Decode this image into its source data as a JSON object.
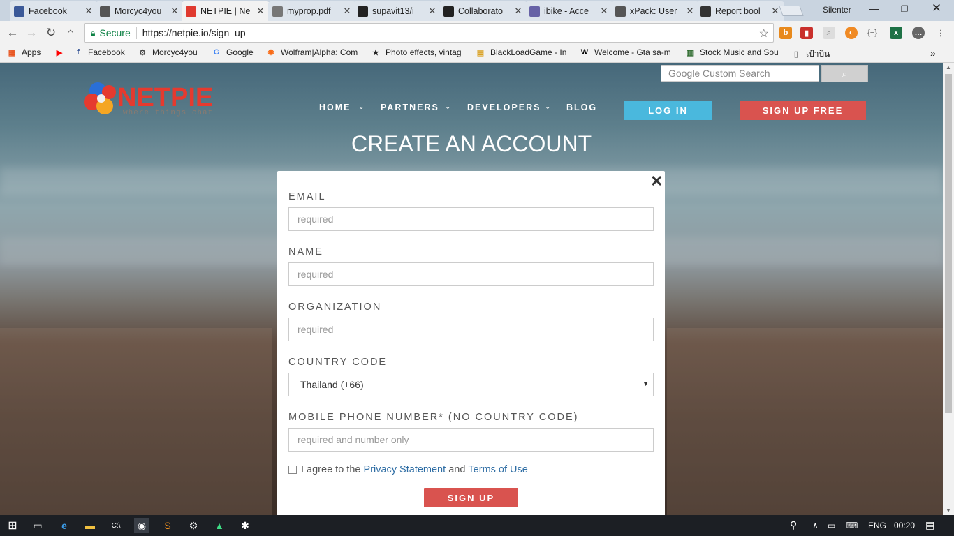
{
  "browser": {
    "tabs": [
      {
        "label": "Facebook",
        "icon": "facebook-icon",
        "color": "#3b5998"
      },
      {
        "label": "Morcyc4you",
        "icon": "motorcycle-icon",
        "color": "#555555"
      },
      {
        "label": "NETPIE | Ne",
        "icon": "netpie-icon",
        "color": "#e03a2f"
      },
      {
        "label": "myprop.pdf",
        "icon": "document-icon",
        "color": "#777777"
      },
      {
        "label": "supavit13/i",
        "icon": "github-icon",
        "color": "#222222"
      },
      {
        "label": "Collaborato",
        "icon": "github-icon",
        "color": "#222222"
      },
      {
        "label": "ibike - Acce",
        "icon": "heroku-icon",
        "color": "#6762a6"
      },
      {
        "label": "xPack: User",
        "icon": "xpack-icon",
        "color": "#555555"
      },
      {
        "label": "Report bool",
        "icon": "report-icon",
        "color": "#333333"
      }
    ],
    "profile_name": "Silenter",
    "secure_label": "Secure",
    "url": "https://netpie.io/sign_up",
    "bookmarks": [
      {
        "label": "Apps",
        "icon": "apps-grid-icon"
      },
      {
        "label": "",
        "icon": "youtube-icon"
      },
      {
        "label": "Facebook",
        "icon": "facebook-icon"
      },
      {
        "label": "Morcyc4you",
        "icon": "motorcycle-icon"
      },
      {
        "label": "Google",
        "icon": "google-icon"
      },
      {
        "label": "Wolfram|Alpha: Com",
        "icon": "wolfram-icon"
      },
      {
        "label": "Photo effects, vintag",
        "icon": "photo-effects-icon"
      },
      {
        "label": "BlackLoadGame - In",
        "icon": "blackload-icon"
      },
      {
        "label": "Welcome - Gta sa-m",
        "icon": "w-icon"
      },
      {
        "label": "Stock Music and Sou",
        "icon": "stock-music-icon"
      },
      {
        "label": "เป้าบิน",
        "icon": "page-icon"
      }
    ]
  },
  "site": {
    "search_placeholder": "Google Custom Search",
    "nav": [
      {
        "label": "HOME",
        "has_dropdown": true
      },
      {
        "label": "PARTNERS",
        "has_dropdown": true
      },
      {
        "label": "DEVELOPERS",
        "has_dropdown": true
      },
      {
        "label": "BLOG",
        "has_dropdown": false
      }
    ],
    "login_label": "LOG IN",
    "signup_free_label": "SIGN UP FREE",
    "logo_text": "NETPIE",
    "logo_tagline": "where things chat"
  },
  "form": {
    "heading": "CREATE AN ACCOUNT",
    "close_symbol": "✕",
    "email_label": "EMAIL",
    "email_placeholder": "required",
    "name_label": "NAME",
    "name_placeholder": "required",
    "org_label": "ORGANIZATION",
    "org_placeholder": "required",
    "country_label": "COUNTRY CODE",
    "country_value": "Thailand (+66)",
    "phone_label": "MOBILE PHONE NUMBER* (NO COUNTRY CODE)",
    "phone_placeholder": "required and number only",
    "agree_prefix": "I agree to the",
    "privacy_link": "Privacy Statement",
    "agree_and": "and",
    "terms_link": "Terms of Use",
    "submit_label": "SIGN UP"
  },
  "taskbar": {
    "language": "ENG",
    "time": "00:20"
  },
  "colors": {
    "accent_red": "#d9534f",
    "accent_blue": "#4ab8dd",
    "link": "#2e6da4"
  }
}
